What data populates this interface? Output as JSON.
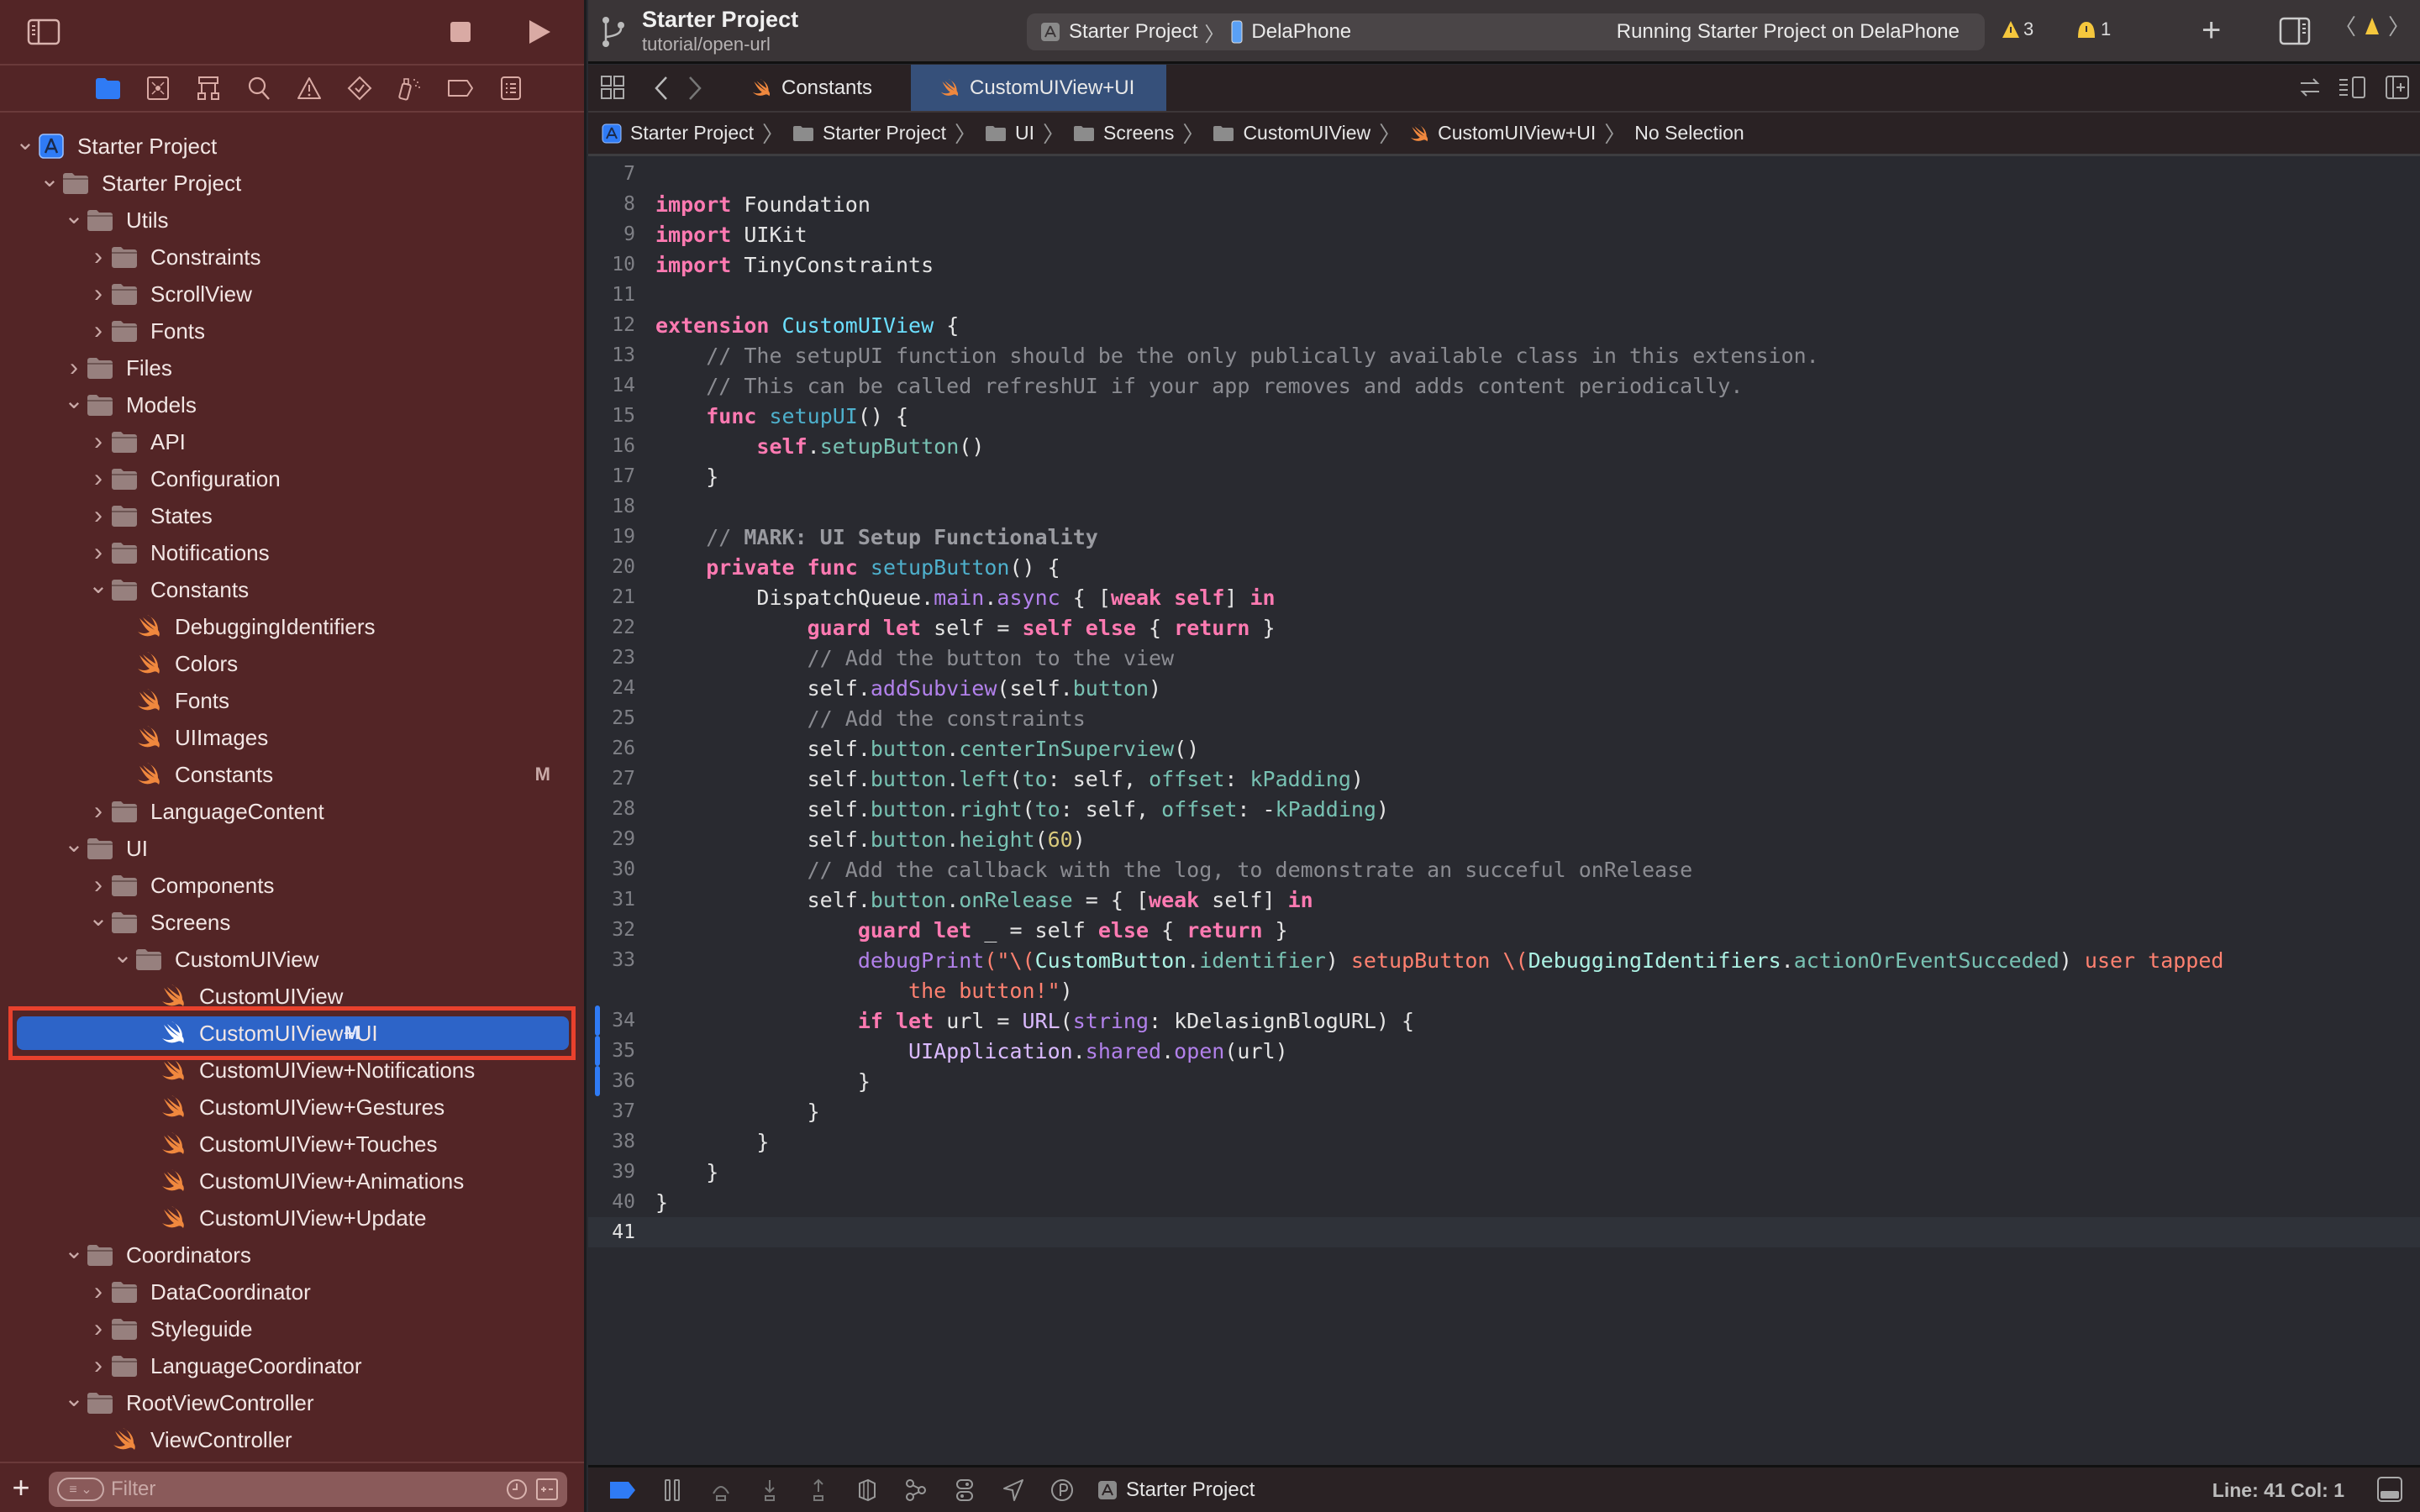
{
  "toolbar": {
    "project_title": "Starter Project",
    "branch": "tutorial/open-url",
    "scheme": "Starter Project",
    "device": "DelaPhone",
    "run_status": "Running Starter Project on DelaPhone",
    "warning_count": "3",
    "issue_count": "1"
  },
  "navigator": {
    "icons": [
      "folder-icon",
      "source-control-icon",
      "hierarchy-icon",
      "search-icon",
      "warning-icon",
      "test-icon",
      "debug-icon",
      "breakpoint-icon",
      "report-icon"
    ],
    "active_icon": "folder-icon",
    "tree": [
      {
        "label": "Starter Project",
        "level": 0,
        "type": "project",
        "expanded": true
      },
      {
        "label": "Starter Project",
        "level": 1,
        "type": "folder",
        "expanded": true
      },
      {
        "label": "Utils",
        "level": 2,
        "type": "folder",
        "expanded": true
      },
      {
        "label": "Constraints",
        "level": 3,
        "type": "folder",
        "expanded": false
      },
      {
        "label": "ScrollView",
        "level": 3,
        "type": "folder",
        "expanded": false
      },
      {
        "label": "Fonts",
        "level": 3,
        "type": "folder",
        "expanded": false
      },
      {
        "label": "Files",
        "level": 2,
        "type": "folder",
        "expanded": false
      },
      {
        "label": "Models",
        "level": 2,
        "type": "folder",
        "expanded": true
      },
      {
        "label": "API",
        "level": 3,
        "type": "folder",
        "expanded": false
      },
      {
        "label": "Configuration",
        "level": 3,
        "type": "folder",
        "expanded": false
      },
      {
        "label": "States",
        "level": 3,
        "type": "folder",
        "expanded": false
      },
      {
        "label": "Notifications",
        "level": 3,
        "type": "folder",
        "expanded": false
      },
      {
        "label": "Constants",
        "level": 3,
        "type": "folder",
        "expanded": true
      },
      {
        "label": "DebuggingIdentifiers",
        "level": 4,
        "type": "swift"
      },
      {
        "label": "Colors",
        "level": 4,
        "type": "swift"
      },
      {
        "label": "Fonts",
        "level": 4,
        "type": "swift"
      },
      {
        "label": "UIImages",
        "level": 4,
        "type": "swift"
      },
      {
        "label": "Constants",
        "level": 4,
        "type": "swift",
        "badge": "M"
      },
      {
        "label": "LanguageContent",
        "level": 3,
        "type": "folder",
        "expanded": false
      },
      {
        "label": "UI",
        "level": 2,
        "type": "folder",
        "expanded": true
      },
      {
        "label": "Components",
        "level": 3,
        "type": "folder",
        "expanded": false
      },
      {
        "label": "Screens",
        "level": 3,
        "type": "folder",
        "expanded": true
      },
      {
        "label": "CustomUIView",
        "level": 4,
        "type": "folder",
        "expanded": true
      },
      {
        "label": "CustomUIView",
        "level": 5,
        "type": "swift"
      },
      {
        "label": "CustomUIView+UI",
        "level": 5,
        "type": "swift",
        "badge": "M",
        "selected": true
      },
      {
        "label": "CustomUIView+Notifications",
        "level": 5,
        "type": "swift"
      },
      {
        "label": "CustomUIView+Gestures",
        "level": 5,
        "type": "swift"
      },
      {
        "label": "CustomUIView+Touches",
        "level": 5,
        "type": "swift"
      },
      {
        "label": "CustomUIView+Animations",
        "level": 5,
        "type": "swift"
      },
      {
        "label": "CustomUIView+Update",
        "level": 5,
        "type": "swift"
      },
      {
        "label": "Coordinators",
        "level": 2,
        "type": "folder",
        "expanded": true
      },
      {
        "label": "DataCoordinator",
        "level": 3,
        "type": "folder",
        "expanded": false
      },
      {
        "label": "Styleguide",
        "level": 3,
        "type": "folder",
        "expanded": false
      },
      {
        "label": "LanguageCoordinator",
        "level": 3,
        "type": "folder",
        "expanded": false
      },
      {
        "label": "RootViewController",
        "level": 2,
        "type": "folder",
        "expanded": true
      },
      {
        "label": "ViewController",
        "level": 3,
        "type": "swift"
      }
    ],
    "filter_placeholder": "Filter"
  },
  "tabs": [
    {
      "label": "Constants",
      "active": false
    },
    {
      "label": "CustomUIView+UI",
      "active": true
    }
  ],
  "breadcrumb": [
    {
      "label": "Starter Project",
      "icon": "app-icon"
    },
    {
      "label": "Starter Project",
      "icon": "folder-icon"
    },
    {
      "label": "UI",
      "icon": "folder-icon"
    },
    {
      "label": "Screens",
      "icon": "folder-icon"
    },
    {
      "label": "CustomUIView",
      "icon": "folder-icon"
    },
    {
      "label": "CustomUIView+UI",
      "icon": "swift-icon"
    },
    {
      "label": "No Selection",
      "icon": ""
    }
  ],
  "editor": {
    "current_line": 41,
    "changed_lines": [
      34,
      35,
      36
    ],
    "lines": [
      {
        "n": "7",
        "tokens": []
      },
      {
        "n": "8",
        "tokens": [
          [
            "k",
            "import"
          ],
          [
            "",
            "",
            " "
          ],
          [
            "",
            "Foundation"
          ]
        ]
      },
      {
        "n": "9",
        "tokens": [
          [
            "k",
            "import"
          ],
          [
            "",
            " UIKit"
          ]
        ]
      },
      {
        "n": "10",
        "tokens": [
          [
            "k",
            "import"
          ],
          [
            "",
            " TinyConstraints"
          ]
        ]
      },
      {
        "n": "11",
        "tokens": []
      },
      {
        "n": "12",
        "tokens": [
          [
            "k",
            "extension"
          ],
          [
            "",
            " "
          ],
          [
            "t",
            "CustomUIView"
          ],
          [
            "",
            " {"
          ]
        ]
      },
      {
        "n": "13",
        "tokens": [
          [
            "c",
            "    // The setupUI function should be the only publically available class in this extension."
          ]
        ]
      },
      {
        "n": "14",
        "tokens": [
          [
            "c",
            "    // This can be called refreshUI if your app removes and adds content periodically."
          ]
        ]
      },
      {
        "n": "15",
        "tokens": [
          [
            "",
            "    "
          ],
          [
            "k",
            "func"
          ],
          [
            "",
            " "
          ],
          [
            "p",
            "setupUI"
          ],
          [
            "",
            "() {"
          ]
        ]
      },
      {
        "n": "16",
        "tokens": [
          [
            "",
            "        "
          ],
          [
            "k",
            "self"
          ],
          [
            "",
            "."
          ],
          [
            "f",
            "setupButton"
          ],
          [
            "",
            "()"
          ]
        ]
      },
      {
        "n": "17",
        "tokens": [
          [
            "",
            "    }"
          ]
        ]
      },
      {
        "n": "18",
        "tokens": []
      },
      {
        "n": "19",
        "tokens": [
          [
            "c",
            "    // "
          ],
          [
            "cm",
            "MARK: UI Setup Functionality"
          ]
        ]
      },
      {
        "n": "20",
        "tokens": [
          [
            "",
            "    "
          ],
          [
            "k",
            "private func"
          ],
          [
            "",
            " "
          ],
          [
            "p",
            "setupButton"
          ],
          [
            "",
            "() {"
          ]
        ]
      },
      {
        "n": "21",
        "tokens": [
          [
            "",
            "        DispatchQueue."
          ],
          [
            "m",
            "main"
          ],
          [
            "",
            "."
          ],
          [
            "m",
            "async"
          ],
          [
            "",
            " { ["
          ],
          [
            "k",
            "weak self"
          ],
          [
            "",
            "] "
          ],
          [
            "k",
            "in"
          ]
        ]
      },
      {
        "n": "22",
        "tokens": [
          [
            "",
            "            "
          ],
          [
            "k",
            "guard let"
          ],
          [
            "",
            " self = "
          ],
          [
            "k",
            "self else"
          ],
          [
            "",
            " { "
          ],
          [
            "k",
            "return"
          ],
          [
            "",
            " }"
          ]
        ]
      },
      {
        "n": "23",
        "tokens": [
          [
            "c",
            "            // Add the button to the view"
          ]
        ]
      },
      {
        "n": "24",
        "tokens": [
          [
            "",
            "            self."
          ],
          [
            "m",
            "addSubview"
          ],
          [
            "",
            "(self."
          ],
          [
            "f",
            "button"
          ],
          [
            "",
            ")"
          ]
        ]
      },
      {
        "n": "25",
        "tokens": [
          [
            "c",
            "            // Add the constraints"
          ]
        ]
      },
      {
        "n": "26",
        "tokens": [
          [
            "",
            "            self."
          ],
          [
            "f",
            "button"
          ],
          [
            "",
            "."
          ],
          [
            "f",
            "centerInSuperview"
          ],
          [
            "",
            "()"
          ]
        ]
      },
      {
        "n": "27",
        "tokens": [
          [
            "",
            "            self."
          ],
          [
            "f",
            "button"
          ],
          [
            "",
            "."
          ],
          [
            "f",
            "left"
          ],
          [
            "",
            "("
          ],
          [
            "f",
            "to"
          ],
          [
            "",
            ": self, "
          ],
          [
            "f",
            "offset"
          ],
          [
            "",
            ": "
          ],
          [
            "f",
            "kPadding"
          ],
          [
            "",
            ")"
          ]
        ]
      },
      {
        "n": "28",
        "tokens": [
          [
            "",
            "            self."
          ],
          [
            "f",
            "button"
          ],
          [
            "",
            "."
          ],
          [
            "f",
            "right"
          ],
          [
            "",
            "("
          ],
          [
            "f",
            "to"
          ],
          [
            "",
            ": self, "
          ],
          [
            "f",
            "offset"
          ],
          [
            "",
            ": -"
          ],
          [
            "f",
            "kPadding"
          ],
          [
            "",
            ")"
          ]
        ]
      },
      {
        "n": "29",
        "tokens": [
          [
            "",
            "            self."
          ],
          [
            "f",
            "button"
          ],
          [
            "",
            "."
          ],
          [
            "f",
            "height"
          ],
          [
            "",
            "("
          ],
          [
            "n",
            "60"
          ],
          [
            "",
            ")"
          ]
        ]
      },
      {
        "n": "30",
        "tokens": [
          [
            "c",
            "            // Add the callback with the log, to demonstrate an succeful onRelease"
          ]
        ]
      },
      {
        "n": "31",
        "tokens": [
          [
            "",
            "            self."
          ],
          [
            "f",
            "button"
          ],
          [
            "",
            "."
          ],
          [
            "f",
            "onRelease"
          ],
          [
            "",
            " = { ["
          ],
          [
            "k",
            "weak"
          ],
          [
            "",
            " self] "
          ],
          [
            "k",
            "in"
          ]
        ]
      },
      {
        "n": "32",
        "tokens": [
          [
            "",
            "                "
          ],
          [
            "k",
            "guard let"
          ],
          [
            "",
            " _ = self "
          ],
          [
            "k",
            "else"
          ],
          [
            "",
            " { "
          ],
          [
            "k",
            "return"
          ],
          [
            "",
            " }"
          ]
        ]
      },
      {
        "n": "33",
        "tokens": [
          [
            "",
            "                "
          ],
          [
            "m",
            "debugPrint"
          ],
          [
            "s",
            "(\"\\("
          ],
          [
            "tc",
            "CustomButton"
          ],
          [
            "",
            "."
          ],
          [
            "f",
            "identifier"
          ],
          [
            "",
            ")"
          ],
          [
            "s",
            " setupButton \\("
          ],
          [
            "tc",
            "DebuggingIdentifiers"
          ],
          [
            "",
            "."
          ],
          [
            "f",
            "actionOrEventSucceded"
          ],
          [
            "",
            ")"
          ],
          [
            "s",
            " user tapped"
          ]
        ]
      },
      {
        "n": "",
        "tokens": [
          [
            "s",
            "                    the button!\""
          ],
          [
            "",
            ")"
          ]
        ]
      },
      {
        "n": "34",
        "tokens": [
          [
            "",
            "                "
          ],
          [
            "k",
            "if let"
          ],
          [
            "",
            " url = "
          ],
          [
            "tc2",
            "URL"
          ],
          [
            "",
            "("
          ],
          [
            "m",
            "string"
          ],
          [
            "",
            ": kDelasignBlogURL) {"
          ]
        ]
      },
      {
        "n": "35",
        "tokens": [
          [
            "",
            "                    "
          ],
          [
            "tc2",
            "UIApplication"
          ],
          [
            "",
            "."
          ],
          [
            "m",
            "shared"
          ],
          [
            "",
            "."
          ],
          [
            "m",
            "open"
          ],
          [
            "",
            "(url)"
          ]
        ]
      },
      {
        "n": "36",
        "tokens": [
          [
            "",
            "                }"
          ]
        ]
      },
      {
        "n": "37",
        "tokens": [
          [
            "",
            "            }"
          ]
        ]
      },
      {
        "n": "38",
        "tokens": [
          [
            "",
            "        }"
          ]
        ]
      },
      {
        "n": "39",
        "tokens": [
          [
            "",
            "    }"
          ]
        ]
      },
      {
        "n": "40",
        "tokens": [
          [
            "",
            "}"
          ]
        ]
      },
      {
        "n": "41",
        "tokens": []
      }
    ]
  },
  "bottombar": {
    "scheme": "Starter Project",
    "cursor": "Line: 41  Col: 1"
  },
  "colors": {
    "sidebar_bg": "#532526",
    "selection": "#2d64c8",
    "highlight_outline": "#e8412d",
    "editor_bg": "#292a30",
    "keyword": "#ff7ab2",
    "comment": "#8b8c92",
    "string": "#ff8170",
    "swift_orange": "#f0883e",
    "warning_yellow": "#f5c73d"
  }
}
